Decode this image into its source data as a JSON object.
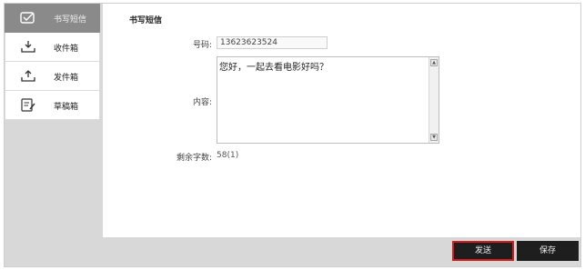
{
  "sidebar": {
    "items": [
      {
        "label": "书写短信",
        "icon": "compose-icon",
        "active": true
      },
      {
        "label": "收件箱",
        "icon": "inbox-icon",
        "active": false
      },
      {
        "label": "发件箱",
        "icon": "outbox-icon",
        "active": false
      },
      {
        "label": "草稿箱",
        "icon": "drafts-icon",
        "active": false
      }
    ]
  },
  "main": {
    "title": "书写短信",
    "number_label": "号码:",
    "number_value": "13623623524",
    "content_label": "内容:",
    "content_value": "您好，一起去看电影好吗？",
    "remaining_label": "剩余字数:",
    "remaining_value": "58(1)"
  },
  "buttons": {
    "send": "发送",
    "save": "保存"
  },
  "colors": {
    "active_item": "#8a8a8a",
    "button_bg": "#1e1e1e",
    "highlight_border": "#d41c1c"
  }
}
